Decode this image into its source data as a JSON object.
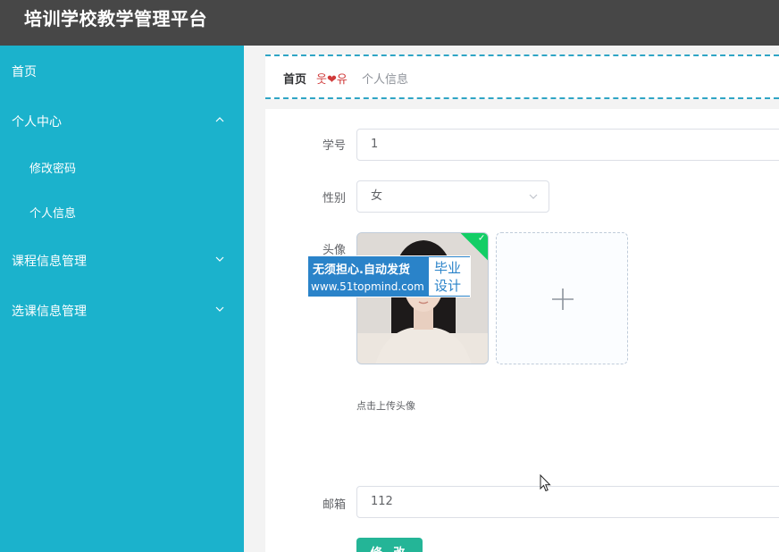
{
  "header": {
    "title": "培训学校教学管理平台"
  },
  "sidebar": {
    "items": [
      {
        "label": "首页"
      },
      {
        "label": "个人中心"
      },
      {
        "label": "修改密码"
      },
      {
        "label": "个人信息"
      },
      {
        "label": "课程信息管理"
      },
      {
        "label": "选课信息管理"
      }
    ]
  },
  "breadcrumb": {
    "home": "首页",
    "separator": "웃❤유",
    "current": "个人信息"
  },
  "form": {
    "student_id": {
      "label": "学号",
      "value": "1"
    },
    "gender": {
      "label": "性别",
      "value": "女"
    },
    "avatar": {
      "label": "头像",
      "hint": "点击上传头像"
    },
    "email": {
      "label": "邮箱",
      "value": "112"
    },
    "submit_label": "修 改"
  },
  "watermark": {
    "line1": "无须担心.自动发货",
    "line2": "www.51topmind.com",
    "box_line1": "毕业",
    "box_line2": "设计"
  },
  "colors": {
    "topbar": "#474747",
    "sidebar": "#1bb2cc",
    "accent_dashed": "#2fa5c5",
    "button": "#24b597",
    "upload_success": "#13ce66"
  }
}
